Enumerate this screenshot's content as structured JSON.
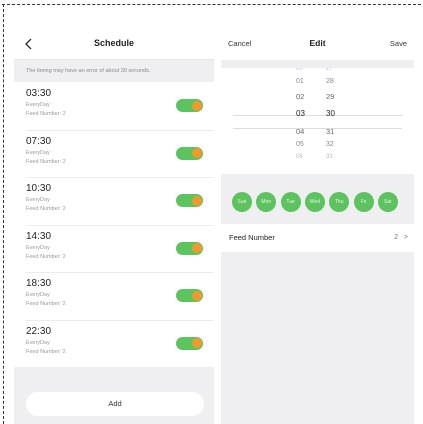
{
  "schedule": {
    "title": "Schedule",
    "notice": "The timing may have an error of about 30 seconds.",
    "items": [
      {
        "time": "03:30",
        "repeat": "EveryDay",
        "feed": "Feed Number: 2",
        "enabled": true
      },
      {
        "time": "07:30",
        "repeat": "EveryDay",
        "feed": "Feed Number: 2",
        "enabled": true
      },
      {
        "time": "10:30",
        "repeat": "EveryDay",
        "feed": "Feed Number: 2",
        "enabled": true
      },
      {
        "time": "14:30",
        "repeat": "EveryDay",
        "feed": "Feed Number: 2",
        "enabled": true
      },
      {
        "time": "18:30",
        "repeat": "EveryDay",
        "feed": "Feed Number: 2",
        "enabled": true
      },
      {
        "time": "22:30",
        "repeat": "EveryDay",
        "feed": "Feed Number: 2",
        "enabled": true
      }
    ],
    "add_label": "Add"
  },
  "edit": {
    "cancel_label": "Cancel",
    "title": "Edit",
    "save_label": "Save",
    "picker": {
      "rows": [
        {
          "hour": "00",
          "minute": "27"
        },
        {
          "hour": "01",
          "minute": "28"
        },
        {
          "hour": "02",
          "minute": "29"
        },
        {
          "hour": "03",
          "minute": "30"
        },
        {
          "hour": "04",
          "minute": "31"
        },
        {
          "hour": "05",
          "minute": "32"
        },
        {
          "hour": "06",
          "minute": "33"
        }
      ],
      "selected_hour": "03",
      "selected_minute": "30"
    },
    "days": [
      "Sun",
      "Mon",
      "Tue",
      "Wed",
      "Thu",
      "Fri",
      "Sat"
    ],
    "feed_label": "Feed Number",
    "feed_value": "2"
  },
  "colors": {
    "toggle_track": "#5cc35e",
    "toggle_knob": "#f09a2d",
    "day_fill": "#5cc35e"
  },
  "icons": {
    "back": "chevron-left-icon",
    "feed_chevron": "chevron-right-icon"
  }
}
